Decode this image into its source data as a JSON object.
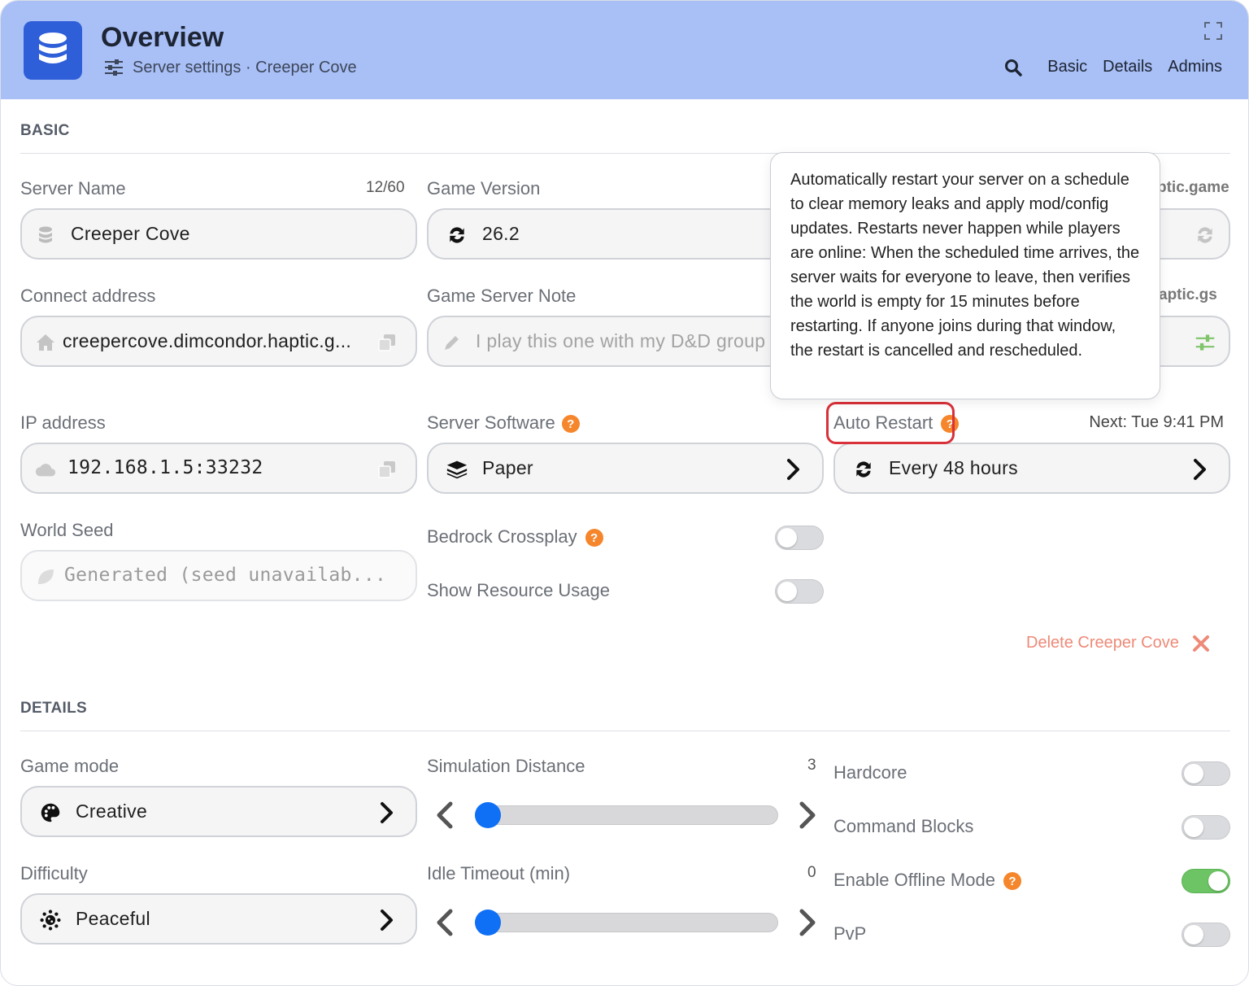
{
  "header": {
    "title": "Overview",
    "subtitle": "Server settings · Creeper Cove",
    "nav": [
      "Basic",
      "Details",
      "Admins"
    ]
  },
  "basic": {
    "section_title": "BASIC",
    "server_name": {
      "label": "Server Name",
      "count": "12/60",
      "value": "Creeper Cove"
    },
    "game_version": {
      "label": "Game Version",
      "value": "26.2"
    },
    "connect_address": {
      "label": "Connect address",
      "value": "creepercove.dimcondor.haptic.g..."
    },
    "game_server_note": {
      "label": "Game Server Note",
      "placeholder": "I play this one with my D&D group"
    },
    "ip_address": {
      "label": "IP address",
      "value": "192.168.1.5:33232"
    },
    "server_software": {
      "label": "Server Software",
      "value": "Paper"
    },
    "auto_restart": {
      "label": "Auto Restart",
      "next": "Next: Tue 9:41 PM",
      "value": "Every 48 hours"
    },
    "world_seed": {
      "label": "World Seed",
      "placeholder": "Generated (seed unavailab..."
    },
    "bedrock_crossplay": {
      "label": "Bedrock Crossplay",
      "on": false
    },
    "show_resource_usage": {
      "label": "Show Resource Usage",
      "on": false
    },
    "delete_label": "Delete Creeper Cove",
    "partial_right_1": "ptic.game",
    "partial_right_2": "aptic.gs"
  },
  "tooltip": {
    "text": "Automatically restart your server on a schedule to clear memory leaks and apply mod/config updates. Restarts never happen while players are online: When the scheduled time arrives, the server waits for everyone to leave, then verifies the world is empty for 15 minutes before restarting. If anyone joins during that window, the restart is cancelled and rescheduled."
  },
  "details": {
    "section_title": "DETAILS",
    "game_mode": {
      "label": "Game mode",
      "value": "Creative"
    },
    "difficulty": {
      "label": "Difficulty",
      "value": "Peaceful"
    },
    "simulation_distance": {
      "label": "Simulation Distance",
      "value": "3"
    },
    "idle_timeout": {
      "label": "Idle Timeout (min)",
      "value": "0"
    },
    "hardcore": {
      "label": "Hardcore",
      "on": false
    },
    "command_blocks": {
      "label": "Command Blocks",
      "on": false
    },
    "offline_mode": {
      "label": "Enable Offline Mode",
      "on": true
    },
    "pvp": {
      "label": "PvP",
      "on": false
    }
  },
  "colors": {
    "header_bg": "#a9c0f7",
    "accent": "#0f6ff5",
    "help": "#f5862c",
    "toggle_on": "#6cc464",
    "danger": "#ee8a78",
    "highlight": "#d9303a"
  }
}
